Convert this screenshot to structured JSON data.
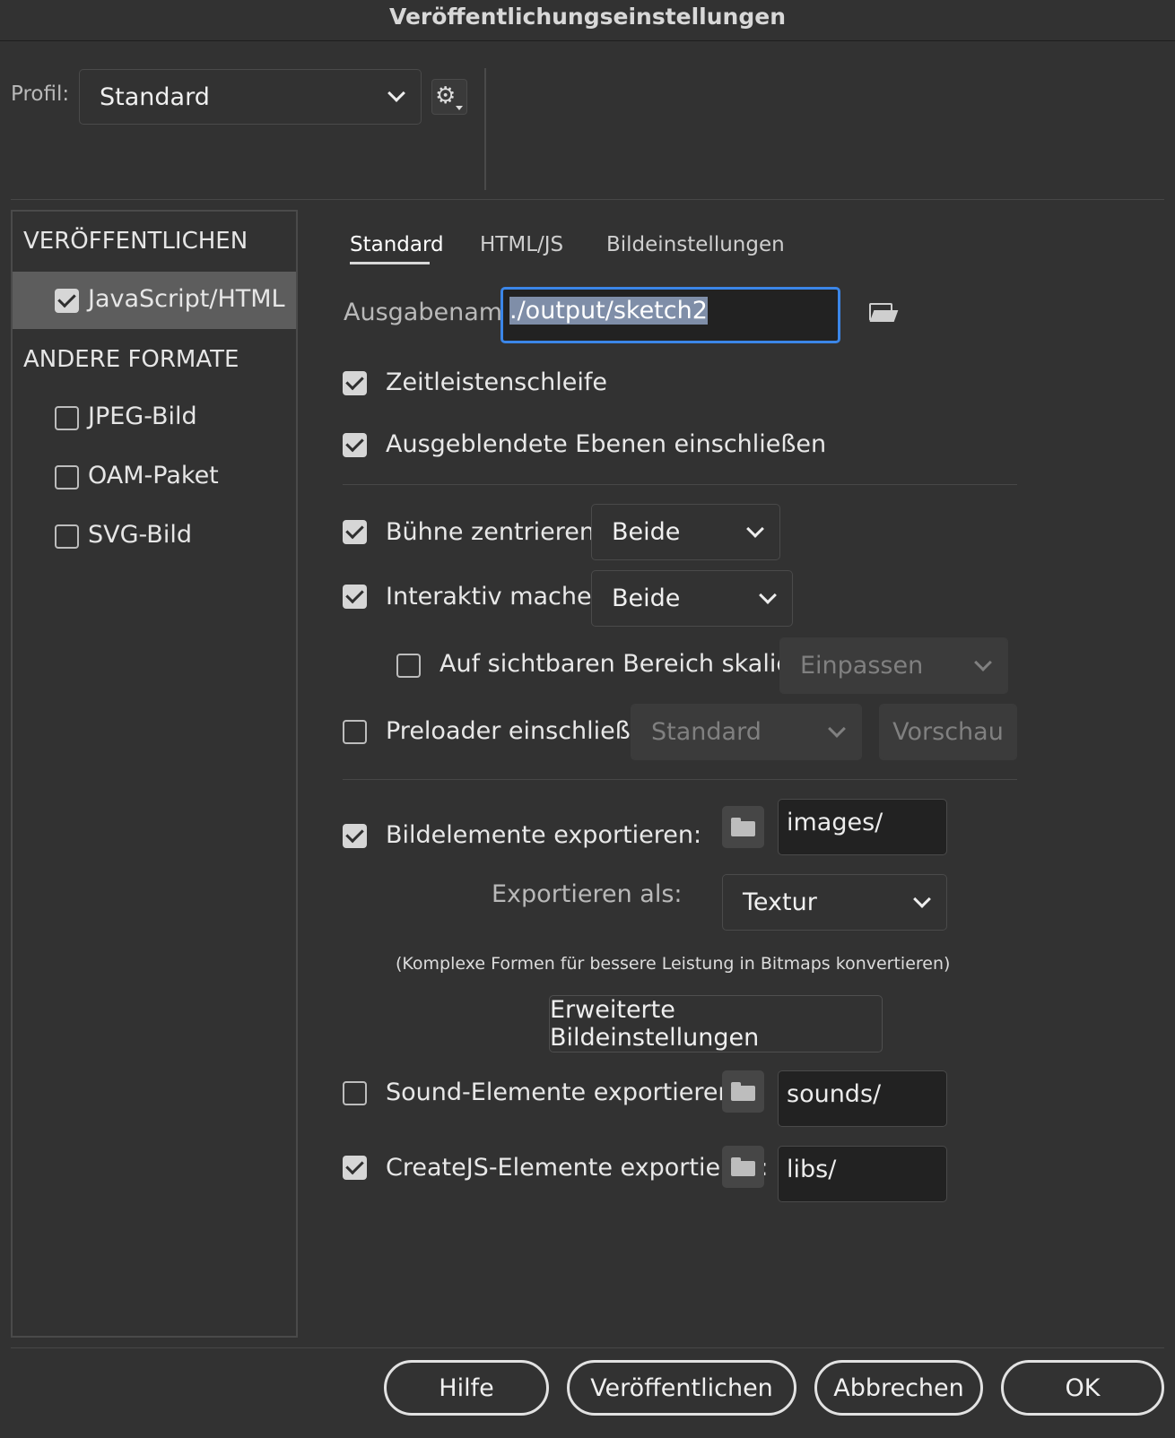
{
  "dialog": {
    "title": "Veröffentlichungseinstellungen"
  },
  "profile": {
    "label": "Profil:",
    "value": "Standard"
  },
  "sidebar": {
    "publish_heading": "VERÖFFENTLICHEN",
    "publish_items": [
      {
        "label": "JavaScript/HTML",
        "checked": true,
        "selected": true
      }
    ],
    "other_heading": "ANDERE FORMATE",
    "other_items": [
      {
        "label": "JPEG-Bild",
        "checked": false
      },
      {
        "label": "OAM-Paket",
        "checked": false
      },
      {
        "label": "SVG-Bild",
        "checked": false
      }
    ]
  },
  "tabs": [
    {
      "label": "Standard",
      "active": true
    },
    {
      "label": "HTML/JS",
      "active": false
    },
    {
      "label": "Bildeinstellungen",
      "active": false
    }
  ],
  "output": {
    "label": "Ausgabename:",
    "value": "./output/sketch2"
  },
  "options": {
    "timeline_loop": {
      "label": "Zeitleistenschleife",
      "checked": true
    },
    "include_hidden_layers": {
      "label": "Ausgeblendete Ebenen einschließen",
      "checked": true
    },
    "center_stage": {
      "label": "Bühne zentrieren",
      "checked": true,
      "value": "Beide"
    },
    "make_responsive": {
      "label": "Interaktiv machen",
      "checked": true,
      "value": "Beide"
    },
    "scale_to_visible": {
      "label": "Auf sichtbaren Bereich skalieren",
      "checked": false,
      "value": "Einpassen"
    },
    "include_preloader": {
      "label": "Preloader einschließen",
      "checked": false,
      "value": "Standard",
      "preview_label": "Vorschau"
    }
  },
  "export": {
    "images": {
      "label": "Bildelemente exportieren:",
      "checked": true,
      "path": "images/"
    },
    "export_as": {
      "label": "Exportieren als:",
      "value": "Textur"
    },
    "hint": "(Komplexe Formen für bessere Leistung in Bitmaps konvertieren)",
    "advanced_button": "Erweiterte Bildeinstellungen",
    "sounds": {
      "label": "Sound-Elemente exportieren:",
      "checked": false,
      "path": "sounds/"
    },
    "createjs": {
      "label": "CreateJS-Elemente exportieren:",
      "checked": true,
      "path": "libs/"
    }
  },
  "footer": {
    "help": "Hilfe",
    "publish": "Veröffentlichen",
    "cancel": "Abbrechen",
    "ok": "OK"
  },
  "colors": {
    "background": "#323232",
    "focus_border": "#3b86e8",
    "sidebar_selected": "#5d5d5d"
  },
  "icons": {
    "gear": "gear-icon",
    "folder": "folder-icon",
    "open_folder": "open-folder-icon",
    "chevron": "chevron-down-icon"
  }
}
